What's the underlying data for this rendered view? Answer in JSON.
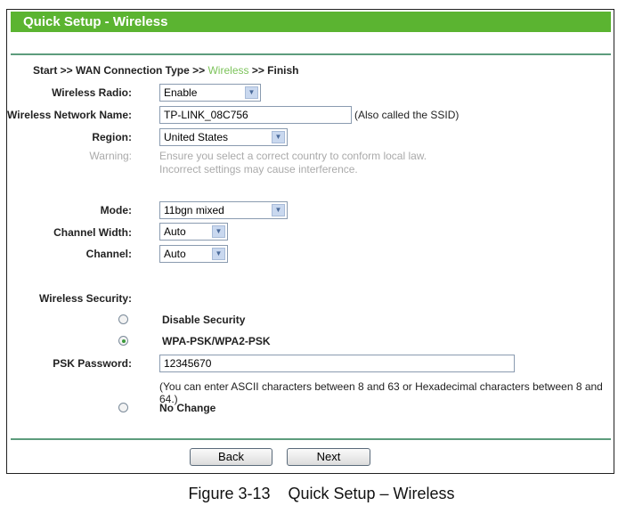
{
  "header": {
    "title": "Quick Setup - Wireless"
  },
  "breadcrumb": {
    "start": "Start >> WAN Connection Type >> ",
    "current": "Wireless",
    "end": " >> Finish"
  },
  "form": {
    "wireless_radio": {
      "label": "Wireless Radio:",
      "value": "Enable"
    },
    "network_name": {
      "label": "Wireless Network Name:",
      "value": "TP-LINK_08C756",
      "hint": "(Also called the SSID)"
    },
    "region": {
      "label": "Region:",
      "value": "United States"
    },
    "warning": {
      "label": "Warning:",
      "line1": "Ensure you select a correct country to conform local law.",
      "line2": "Incorrect settings may cause interference."
    },
    "mode": {
      "label": "Mode:",
      "value": "11bgn mixed"
    },
    "channel_width": {
      "label": "Channel Width:",
      "value": "Auto"
    },
    "channel": {
      "label": "Channel:",
      "value": "Auto"
    },
    "security": {
      "label": "Wireless Security:",
      "options": [
        "Disable Security",
        "WPA-PSK/WPA2-PSK",
        "No Change"
      ],
      "selected": "WPA-PSK/WPA2-PSK"
    },
    "psk": {
      "label": "PSK Password:",
      "value": "12345670",
      "hint": "(You can enter ASCII characters between 8 and 63 or Hexadecimal characters between 8 and 64.)"
    }
  },
  "buttons": {
    "back": "Back",
    "next": "Next"
  },
  "caption": "Figure 3-13    Quick Setup – Wireless",
  "colors": {
    "header": "#5bb431",
    "accent_text": "#7cc35a"
  }
}
